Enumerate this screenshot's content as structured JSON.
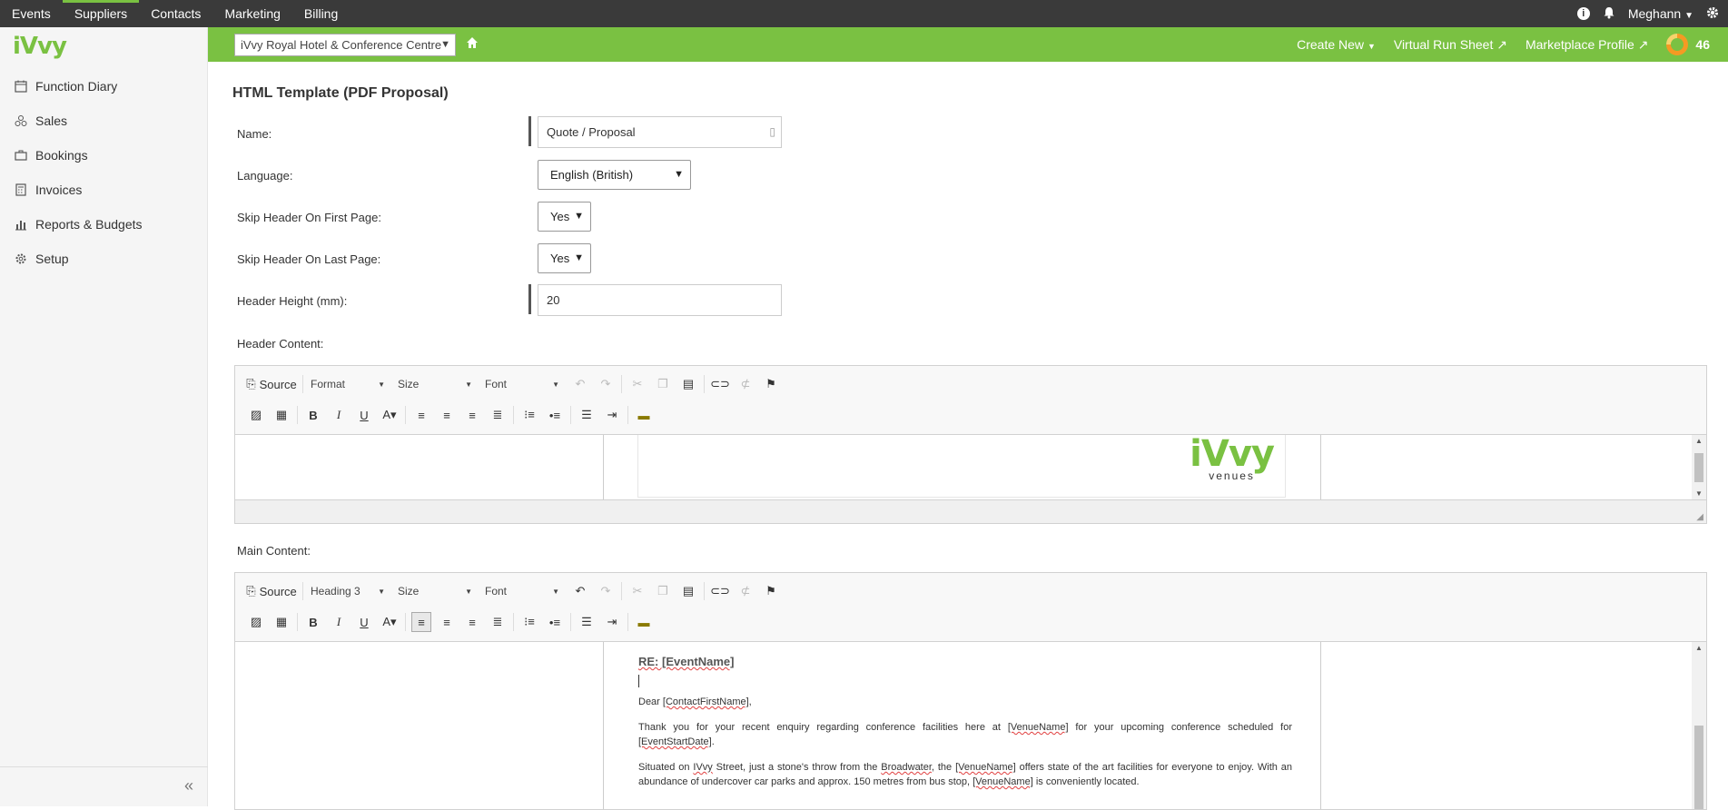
{
  "topnav": {
    "tabs": [
      "Events",
      "Suppliers",
      "Contacts",
      "Marketing",
      "Billing"
    ],
    "active_tab": "Suppliers",
    "user": "Meghann"
  },
  "sidebar": {
    "logo": "iVvy",
    "items": [
      {
        "label": "Function Diary",
        "icon": "calendar-icon"
      },
      {
        "label": "Sales",
        "icon": "sales-icon"
      },
      {
        "label": "Bookings",
        "icon": "briefcase-icon"
      },
      {
        "label": "Invoices",
        "icon": "calculator-icon"
      },
      {
        "label": "Reports & Budgets",
        "icon": "bar-chart-icon"
      },
      {
        "label": "Setup",
        "icon": "gear-icon"
      }
    ],
    "collapse_label": "«"
  },
  "venuebar": {
    "venue": "iVvy Royal Hotel & Conference Centre",
    "create_new": "Create New",
    "virtual_run_sheet": "Virtual Run Sheet",
    "marketplace_profile": "Marketplace Profile",
    "score": "46",
    "colors": {
      "green": "#7ac142",
      "dark": "#3a3a3a"
    }
  },
  "form": {
    "title": "HTML Template (PDF Proposal)",
    "name_label": "Name:",
    "name_value": "Quote / Proposal",
    "language_label": "Language:",
    "language_value": "English (British)",
    "skip_first_label": "Skip Header On First Page:",
    "skip_first_value": "Yes",
    "skip_last_label": "Skip Header On Last Page:",
    "skip_last_value": "Yes",
    "header_height_label": "Header Height (mm):",
    "header_height_value": "20",
    "header_content_label": "Header Content:",
    "main_content_label": "Main Content:"
  },
  "header_editor": {
    "source": "Source",
    "format": "Format",
    "size": "Size",
    "font": "Font",
    "logo_text": "iVvy",
    "logo_sub": "venues"
  },
  "main_editor": {
    "source": "Source",
    "format": "Heading 3",
    "size": "Size",
    "font": "Font",
    "heading": "RE: [EventName]",
    "dear_prefix": "Dear ",
    "dear_field": "[ContactFirstName]",
    "dear_suffix": ",",
    "p1_a": "Thank you for your recent enquiry regarding conference facilities here at ",
    "p1_venue": "[VenueName]",
    "p1_b": " for your upcoming conference scheduled for ",
    "p1_date": "[EventStartDate]",
    "p1_c": ".",
    "p2_a": "Situated on ",
    "p2_ivvy": "IVvy",
    "p2_b": " Street, just a stone's throw from the ",
    "p2_broadwater": "Broadwater",
    "p2_c": ", the ",
    "p2_venue": "[VenueName]",
    "p2_d": " offers state of the art facilities for everyone to enjoy. With an abundance of undercover car parks and approx. 150 metres from bus stop, ",
    "p2_venue2": "[VenueName]",
    "p2_e": " is conveniently located."
  }
}
